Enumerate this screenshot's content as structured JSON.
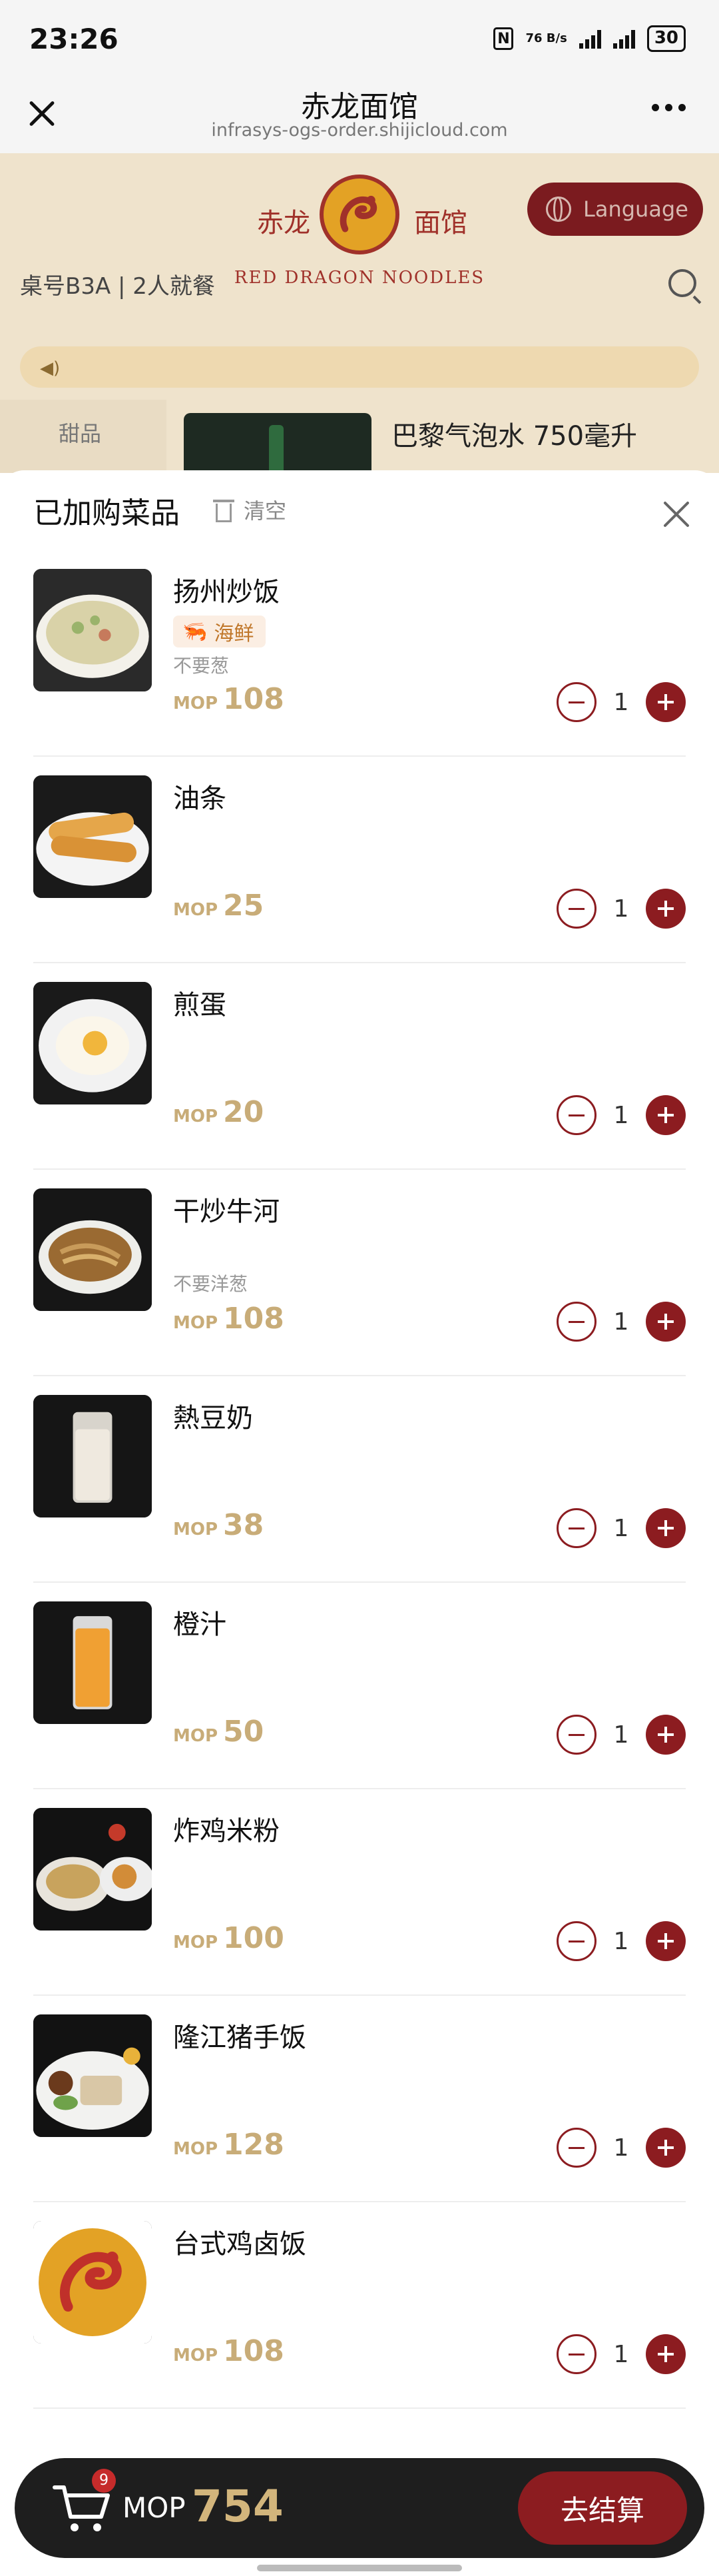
{
  "status_bar": {
    "time": "23:26",
    "net_speed": "76 B/s",
    "battery": "30"
  },
  "titlebar": {
    "title": "赤龙面馆",
    "url": "infrasys-ogs-order.shijicloud.com"
  },
  "background_page": {
    "logo_cn_left": "赤龙",
    "logo_cn_right": "面馆",
    "logo_en": "RED DRAGON NOODLES",
    "language_button": "Language",
    "table_info": "桌号B3A | 2人就餐",
    "category": "甜品",
    "item_name": "巴黎气泡水 750毫升"
  },
  "cart_sheet": {
    "title": "已加购菜品",
    "clear_label": "清空",
    "currency": "MOP",
    "items": [
      {
        "name": "扬州炒饭",
        "tag": "海鲜",
        "note": "不要葱",
        "price": "108",
        "qty": "1",
        "image": "fried-rice"
      },
      {
        "name": "油条",
        "tag": "",
        "note": "",
        "price": "25",
        "qty": "1",
        "image": "fried-dough"
      },
      {
        "name": "煎蛋",
        "tag": "",
        "note": "",
        "price": "20",
        "qty": "1",
        "image": "fried-egg"
      },
      {
        "name": "干炒牛河",
        "tag": "",
        "note": "不要洋葱",
        "price": "108",
        "qty": "1",
        "image": "beef-noodles"
      },
      {
        "name": "熱豆奶",
        "tag": "",
        "note": "",
        "price": "38",
        "qty": "1",
        "image": "soy-milk"
      },
      {
        "name": "橙汁",
        "tag": "",
        "note": "",
        "price": "50",
        "qty": "1",
        "image": "orange-juice"
      },
      {
        "name": "炸鸡米粉",
        "tag": "",
        "note": "",
        "price": "100",
        "qty": "1",
        "image": "chicken-rice-noodles"
      },
      {
        "name": "隆江猪手饭",
        "tag": "",
        "note": "",
        "price": "128",
        "qty": "1",
        "image": "pork-knuckle-rice"
      },
      {
        "name": "台式鸡卤饭",
        "tag": "",
        "note": "",
        "price": "108",
        "qty": "1",
        "image": "dragon-logo"
      }
    ]
  },
  "cart_bar": {
    "badge_count": "9",
    "currency": "MOP",
    "total": "754",
    "checkout_label": "去结算"
  }
}
